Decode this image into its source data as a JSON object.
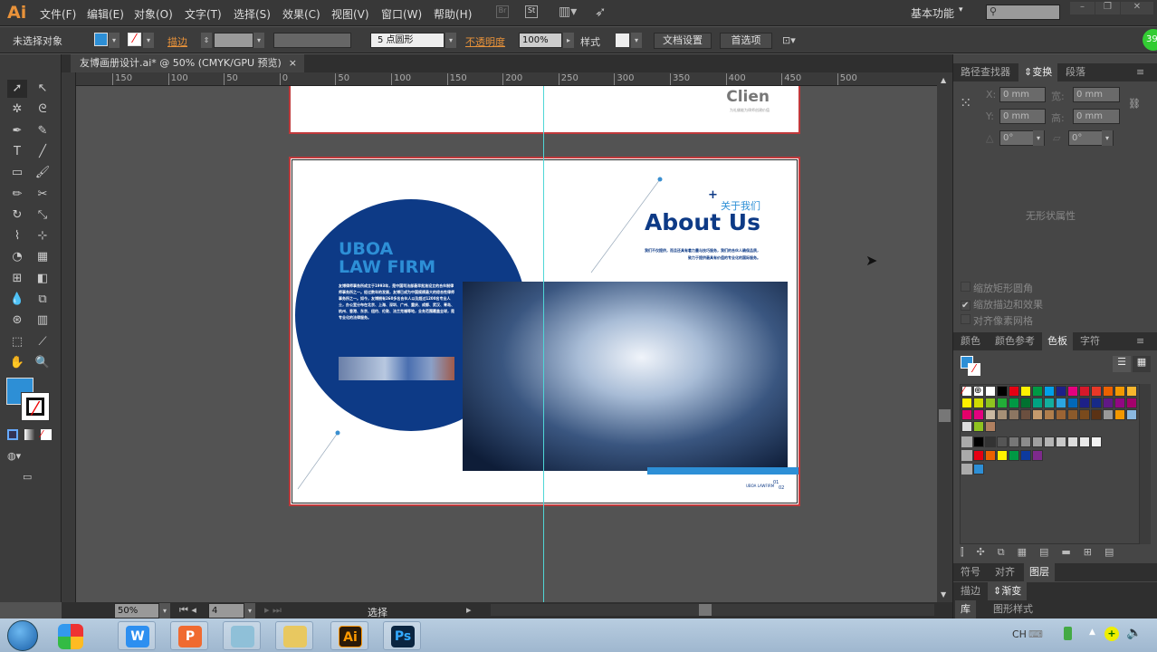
{
  "app": {
    "logo": "Ai",
    "workspace": "基本功能"
  },
  "menu": [
    "文件(F)",
    "编辑(E)",
    "对象(O)",
    "文字(T)",
    "选择(S)",
    "效果(C)",
    "视图(V)",
    "窗口(W)",
    "帮助(H)"
  ],
  "menu_icons": [
    "bridge-icon",
    "stock-icon",
    "arrange-documents-icon",
    "gpu-rocket-icon"
  ],
  "control": {
    "selection": "未选择对象",
    "stroke_label": "描边",
    "brush": "5 点圆形",
    "opacity_label": "不透明度",
    "opacity": "100%",
    "style_label": "样式",
    "doc_setup": "文档设置",
    "preferences": "首选项",
    "fill_color": "#2d8fd6"
  },
  "badge": "39",
  "document_tab": {
    "title": "友博画册设计.ai* @ 50% (CMYK/GPU 预览)",
    "close": "×"
  },
  "ruler": [
    "150",
    "100",
    "50",
    "0",
    "50",
    "100",
    "150",
    "200",
    "250",
    "300",
    "350",
    "400",
    "450",
    "500"
  ],
  "artboard_top": {
    "title": "Clien",
    "subtitle": "为礼佛能为律师创建价值"
  },
  "artboard_main": {
    "uboa": "UBOA",
    "law_firm": "LAW FIRM",
    "body": "友博律师事务所成立于1993年，是中国司法部最早批准设立的合伙制律师事务所之一。经过数年的发展，友博已成为中国规模最大的综合性律师事务所之一。如今，友博拥有260多名合伙人以及超过1200名专业人士，办公室分布在北京、上海、深圳、广州、重庆、成都、武汉、青岛、杭州、香港、东京、纽约、伦敦、法兰克福等地，业务范围覆盖全球，是专业化的法律服务。",
    "about_cn": "关于我们",
    "about_en": "About Us",
    "plus": "+",
    "about_body_1": "我们不仅提供，而且还具有着力量与技巧服务，我们的合伙人确保品质，",
    "about_body_2": "致力于提供最具有价值的专业化的国际服务。",
    "footer_small": "UBOA LAWFIRM",
    "page_num_top": "01",
    "page_num_bottom": "02",
    "navy": "#0d3a86",
    "accent": "#2d8fd6"
  },
  "transform": {
    "tabs": [
      "路径查找器",
      "变换",
      "段落"
    ],
    "x_label": "X:",
    "y_label": "Y:",
    "w_label": "宽:",
    "h_label": "高:",
    "x": "0 mm",
    "y": "0 mm",
    "w": "0 mm",
    "h": "0 mm",
    "rotate": "0°",
    "shear": "0°",
    "no_shape": "无形状属性",
    "checks": [
      {
        "label": "缩放矩形圆角",
        "checked": false
      },
      {
        "label": "缩放描边和效果",
        "checked": true
      },
      {
        "label": "对齐像素网格",
        "checked": false
      }
    ]
  },
  "swatch_panel": {
    "tabs": [
      "颜色",
      "颜色参考",
      "色板",
      "字符"
    ],
    "rows": [
      [
        "#ffffff",
        "#ffffff",
        "#ffffff",
        "#000000",
        "#e60012",
        "#fff100",
        "#009944",
        "#00a0e9",
        "#1d2088",
        "#e4007f",
        "#d7182a",
        "#e83828",
        "#eb6100",
        "#f39800",
        "#f8b62d"
      ],
      [
        "#fff100",
        "#cfdb00",
        "#8fc31f",
        "#22ac38",
        "#009944",
        "#007130",
        "#00a381",
        "#13ae9e",
        "#2ca6e0",
        "#0068b7",
        "#1d2088",
        "#172a88",
        "#601986",
        "#920783",
        "#a4006b"
      ],
      [
        "#e5006a",
        "#e4007f",
        "#c9b8a1",
        "#a69076",
        "#8c7662",
        "#6b4f3f",
        "#c49a6c",
        "#b07e4c",
        "#9b6434",
        "#8b5a2b",
        "#7a4a1c",
        "#5b3215",
        "#999999",
        "#f39800",
        "#8ab8e0"
      ],
      [
        "#dddddd",
        "#8fc31f",
        "#b08060"
      ]
    ],
    "groups": [
      [
        "#000000",
        "#333333",
        "#555555",
        "#777777",
        "#8c8c8c",
        "#a0a0a0",
        "#b4b4b4",
        "#c8c8c8",
        "#dcdcdc",
        "#e8e8e8",
        "#f4f4f4"
      ],
      [
        "#e60012",
        "#eb6100",
        "#fff100",
        "#009944",
        "#0d3a9e",
        "#7d2a8c"
      ],
      [
        "#2d8fd6"
      ]
    ]
  },
  "lower_tabs": {
    "row1": [
      "符号",
      "对齐",
      "图层"
    ],
    "row2": [
      "描边",
      "渐变"
    ],
    "row3": [
      "库",
      "图形样式"
    ]
  },
  "status": {
    "zoom": "50%",
    "artboard": "4",
    "tool": "选择"
  },
  "taskbar": {
    "apps": [
      {
        "name": "wps-writer",
        "label": "W",
        "color": "#2d8ff0"
      },
      {
        "name": "wps-presentation",
        "label": "P",
        "color": "#f06a30"
      },
      {
        "name": "notepad",
        "label": "",
        "color": "#8fc0d8"
      },
      {
        "name": "file-explorer",
        "label": "",
        "color": "#e8c860"
      },
      {
        "name": "illustrator",
        "label": "Ai",
        "color": "#2b1a08"
      },
      {
        "name": "photoshop",
        "label": "Ps",
        "color": "#0b2540"
      }
    ],
    "lang": "CH"
  }
}
